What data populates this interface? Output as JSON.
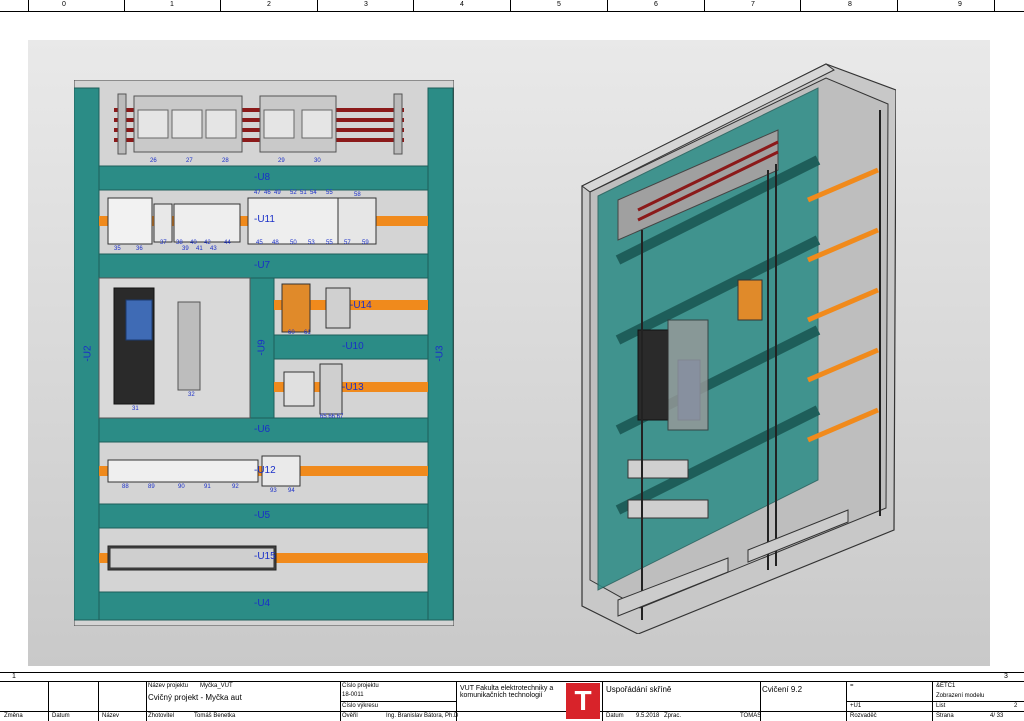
{
  "ruler": [
    "0",
    "1",
    "2",
    "3",
    "4",
    "5",
    "6",
    "7",
    "8",
    "9"
  ],
  "front_view": {
    "rails": [
      "-U8",
      "-U7",
      "-U6",
      "-U5",
      "-U4"
    ],
    "side_left": "-U2",
    "side_right": "-U3",
    "mid_vertical": "-U9",
    "ducts": [
      "-U11",
      "-U14",
      "-U10",
      "-U13",
      "-U12",
      "-U15"
    ],
    "row1_numbers": [
      "26",
      "27",
      "28",
      "29",
      "30"
    ],
    "row2_top_numbers": [
      "47",
      "46",
      "49",
      "52",
      "51",
      "54",
      "55",
      "58"
    ],
    "row2_bottom_numbers": [
      "35",
      "36",
      "37",
      "38",
      "40",
      "42",
      "44",
      "45",
      "48",
      "50",
      "53",
      "55",
      "57",
      "59"
    ],
    "row2_sub_numbers": [
      "39",
      "41",
      "43"
    ],
    "drive_labels": [
      "31",
      "32"
    ],
    "psu_numbers": [
      "60",
      "61"
    ],
    "u13_numbers": "65 66 67",
    "row4_numbers": [
      "88",
      "89",
      "90",
      "91",
      "92",
      "93",
      "94"
    ]
  },
  "border_numbers": {
    "left": "1",
    "right": "3"
  },
  "title_block": {
    "zmena": "Změna",
    "datum": "Datum",
    "nazev": "Název",
    "nazev_projektu_label": "Název projektu",
    "nazev_projektu": "Myčka_VUT",
    "popis": "Cvičný projekt - Myčka aut",
    "zhotovitel_label": "Zhotovitel",
    "zhotovitel": "Tomáš Benetka",
    "cislo_projektu_label": "Číslo projektu",
    "cislo_projektu": "18-0011",
    "cislo_vykresu_label": "Číslo výkresu",
    "overil_label": "Ověřil",
    "overil": "Ing. Branislav Bátora, Ph.D",
    "firma": "VUT Fakulta elektrotechniky a komunikačních technologií",
    "logo_letter": "T",
    "obsah": "Uspořádání skříně",
    "datum_label": "Datum",
    "datum_hodnota": "9.5.2018",
    "zprac_label": "Zprac.",
    "zprac": "TOMÁŠ",
    "cviceni": "Cvičení 9.2",
    "eq": "=",
    "plus_u1": "+U1",
    "rozvadec": "Rozvaděč",
    "code": "&ETC1",
    "zobrazeni": "Zobrazení modelu",
    "list_label": "List",
    "list": "2",
    "strana_label": "Strana",
    "strana": "4/ 33"
  }
}
